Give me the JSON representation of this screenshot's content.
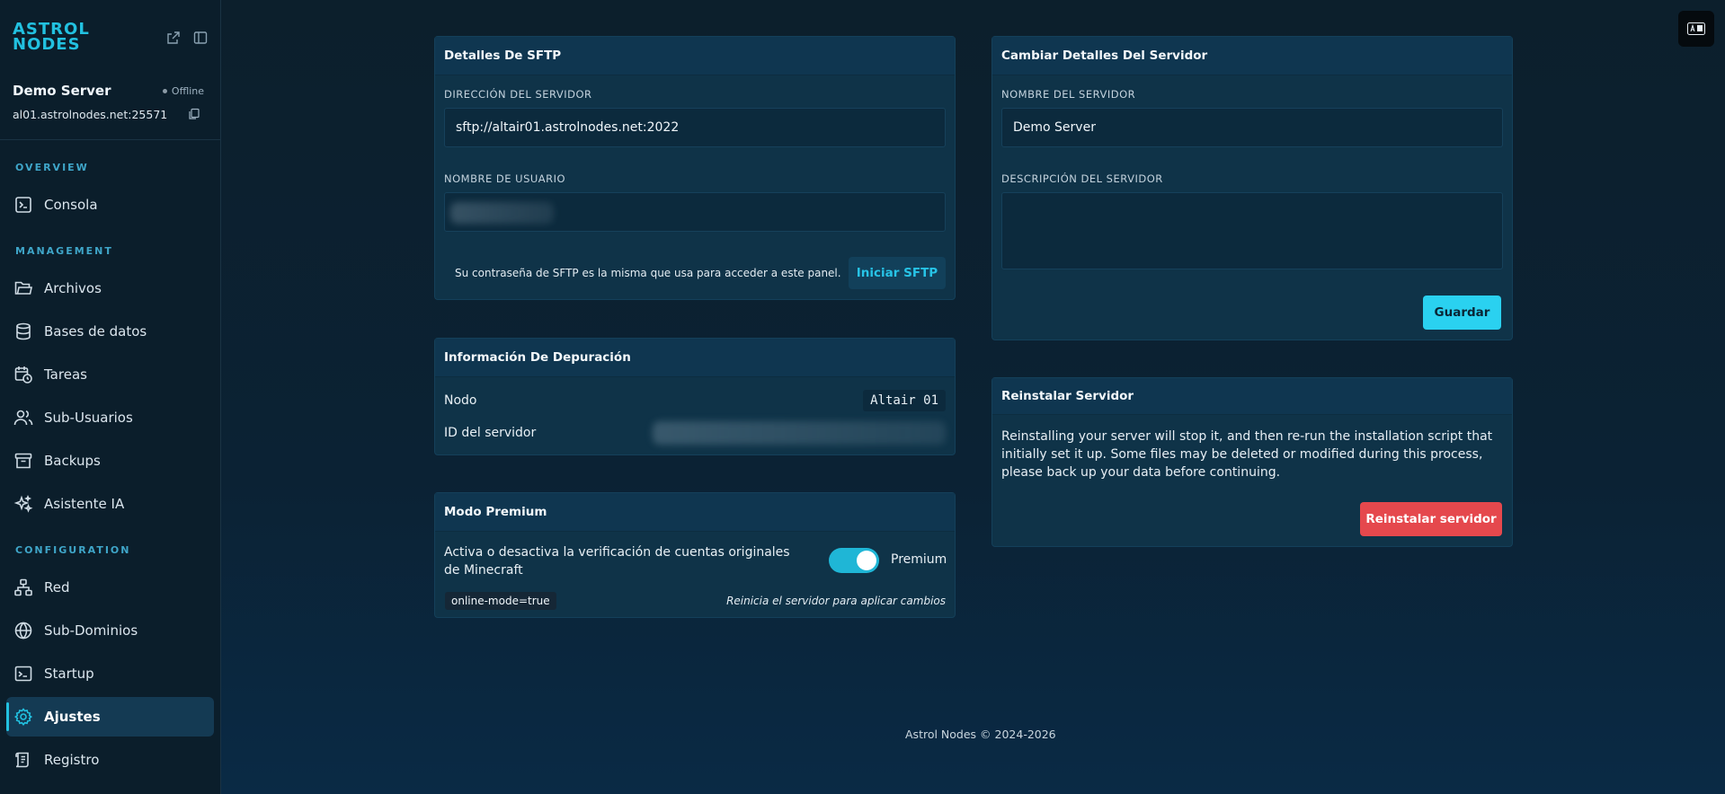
{
  "brand": {
    "line1": "ASTROL",
    "line2": "NODES",
    "accent": "#22c1e0"
  },
  "server": {
    "name": "Demo Server",
    "status": "Offline",
    "address": "al01.astrolnodes.net:25571"
  },
  "sidebar": {
    "sections": [
      {
        "label": "OVERVIEW"
      },
      {
        "label": "MANAGEMENT"
      },
      {
        "label": "CONFIGURATION"
      }
    ],
    "items": [
      {
        "label": "Consola",
        "icon": "terminal-icon"
      },
      {
        "label": "Archivos",
        "icon": "folder-icon"
      },
      {
        "label": "Bases de datos",
        "icon": "database-icon"
      },
      {
        "label": "Tareas",
        "icon": "calendar-clock-icon"
      },
      {
        "label": "Sub-Usuarios",
        "icon": "users-icon"
      },
      {
        "label": "Backups",
        "icon": "archive-icon"
      },
      {
        "label": "Asistente IA",
        "icon": "sparkles-icon"
      },
      {
        "label": "Red",
        "icon": "network-icon"
      },
      {
        "label": "Sub-Dominios",
        "icon": "globe-icon"
      },
      {
        "label": "Startup",
        "icon": "terminal-window-icon"
      },
      {
        "label": "Ajustes",
        "icon": "gear-icon",
        "active": true
      },
      {
        "label": "Registro",
        "icon": "scroll-icon"
      }
    ]
  },
  "sftp": {
    "title": "Detalles De SFTP",
    "address_label": "DIRECCIÓN DEL SERVIDOR",
    "address_value": "sftp://altair01.astrolnodes.net:2022",
    "username_label": "NOMBRE DE USUARIO",
    "note": "Su contraseña de SFTP es la misma que usa para acceder a este panel.",
    "button": "Iniciar SFTP"
  },
  "debug": {
    "title": "Información De Depuración",
    "node_label": "Nodo",
    "node_value": "Altair 01",
    "id_label": "ID del servidor"
  },
  "premium": {
    "title": "Modo Premium",
    "description": "Activa o desactiva la verificación de cuentas originales de Minecraft",
    "toggle_label": "Premium",
    "toggle_on": true,
    "code": "online-mode=true",
    "hint": "Reinicia el servidor para aplicar cambios"
  },
  "details": {
    "title": "Cambiar Detalles Del Servidor",
    "name_label": "NOMBRE DEL SERVIDOR",
    "name_value": "Demo Server",
    "desc_label": "DESCRIPCIÓN DEL SERVIDOR",
    "desc_value": "",
    "save": "Guardar"
  },
  "reinstall": {
    "title": "Reinstalar Servidor",
    "text": "Reinstalling your server will stop it, and then re-run the installation script that initially set it up. Some files may be deleted or modified during this process, please back up your data before continuing.",
    "button": "Reinstalar servidor"
  },
  "footer": "Astrol Nodes © 2024-2026"
}
